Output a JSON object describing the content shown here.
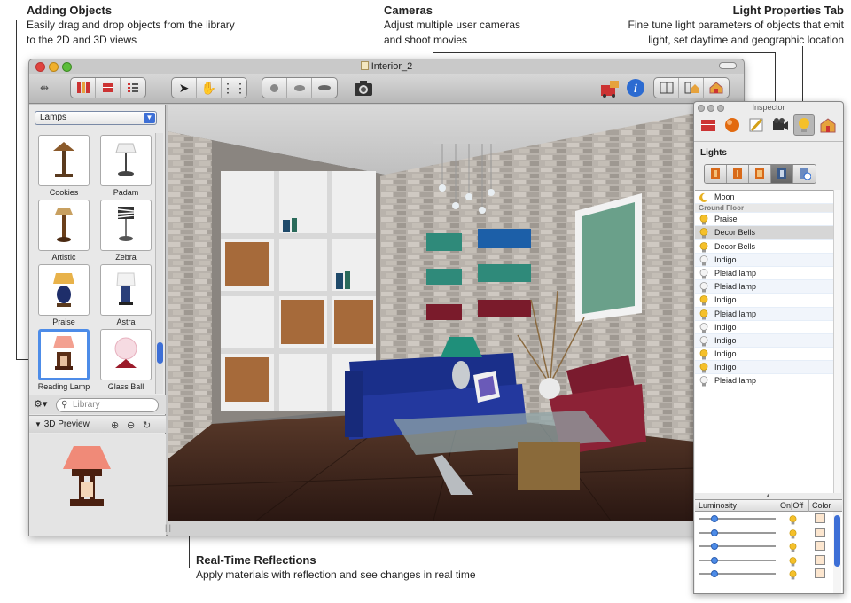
{
  "annotations": {
    "adding_objects": {
      "title": "Adding Objects",
      "line1": "Easily drag and drop objects from the library",
      "line2": "to the 2D and 3D views"
    },
    "cameras": {
      "title": "Cameras",
      "line1": "Adjust multiple user cameras",
      "line2": "and shoot movies"
    },
    "light_tab": {
      "title": "Light Properties Tab",
      "line1": "Fine tune light parameters of objects that emit",
      "line2": "light, set daytime and geographic location"
    },
    "reflections": {
      "title": "Real-Time Reflections",
      "line1": "Apply materials with reflection and see changes in real time"
    }
  },
  "window": {
    "title": "Interior_2"
  },
  "library": {
    "category": "Lamps",
    "items": [
      {
        "label": "Cookies"
      },
      {
        "label": "Padam"
      },
      {
        "label": "Artistic"
      },
      {
        "label": "Zebra"
      },
      {
        "label": "Praise"
      },
      {
        "label": "Astra"
      },
      {
        "label": "Reading Lamp",
        "selected": true
      },
      {
        "label": "Glass Ball"
      }
    ],
    "search_placeholder": "Library",
    "preview_label": "3D Preview"
  },
  "inspector": {
    "title": "Inspector",
    "lights_label": "Lights",
    "list": [
      {
        "label": "Moon",
        "icon": "moon-icon"
      },
      {
        "label": "Ground Floor",
        "section": true
      },
      {
        "label": "Praise",
        "on": true
      },
      {
        "label": "Decor Bells",
        "on": true,
        "selected": true
      },
      {
        "label": "Decor Bells",
        "on": true
      },
      {
        "label": "Indigo",
        "on": false
      },
      {
        "label": "Pleiad lamp",
        "on": false
      },
      {
        "label": "Pleiad lamp",
        "on": false
      },
      {
        "label": "Indigo",
        "on": true
      },
      {
        "label": "Pleiad lamp",
        "on": true
      },
      {
        "label": "Indigo",
        "on": false
      },
      {
        "label": "Indigo",
        "on": false
      },
      {
        "label": "Indigo",
        "on": true
      },
      {
        "label": "Indigo",
        "on": true
      },
      {
        "label": "Pleiad lamp",
        "on": false
      }
    ],
    "columns": {
      "luminosity": "Luminosity",
      "onoff": "On|Off",
      "color": "Color"
    },
    "lum_levels": [
      0.2,
      0.2,
      0.2,
      0.2,
      0.2
    ]
  },
  "colors": {
    "accent": "#3d6fd6",
    "selection": "#4d8ce8",
    "bulb_on": "#f5c02a"
  }
}
